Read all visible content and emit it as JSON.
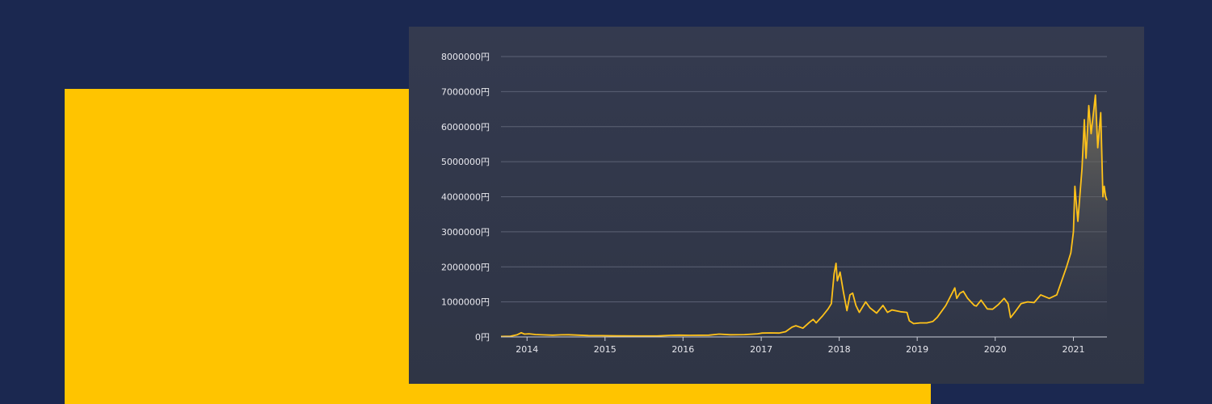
{
  "colors": {
    "background": "#1b2850",
    "accent": "#ffc400",
    "card": "#323849",
    "line": "#ffc21a",
    "grid": "#5c6275",
    "text": "#e8e8ee"
  },
  "chart_data": {
    "type": "area",
    "title": "",
    "xlabel": "",
    "ylabel": "",
    "ylim": [
      0,
      8000000
    ],
    "xlim": [
      "2013-09-01",
      "2021-06-07"
    ],
    "yticks": [
      0,
      1000000,
      2000000,
      3000000,
      4000000,
      5000000,
      6000000,
      7000000,
      8000000
    ],
    "ytick_labels": [
      "0円",
      "1000000円",
      "2000000円",
      "3000000円",
      "4000000円",
      "5000000円",
      "6000000円",
      "7000000円",
      "8000000円"
    ],
    "xticks": [
      "2014-01-01",
      "2015-01-01",
      "2016-01-01",
      "2017-01-01",
      "2018-01-01",
      "2019-01-01",
      "2020-01-01",
      "2021-01-01"
    ],
    "xtick_labels": [
      "2014",
      "2015",
      "2016",
      "2017",
      "2018",
      "2019",
      "2020",
      "2021"
    ],
    "grid": true,
    "legend": "none",
    "series": [
      {
        "points": [
          [
            "2013-09-01",
            13000
          ],
          [
            "2013-10-15",
            20000
          ],
          [
            "2013-11-15",
            60000
          ],
          [
            "2013-12-05",
            120000
          ],
          [
            "2013-12-20",
            80000
          ],
          [
            "2014-01-10",
            90000
          ],
          [
            "2014-02-10",
            70000
          ],
          [
            "2014-03-15",
            60000
          ],
          [
            "2014-05-01",
            50000
          ],
          [
            "2014-06-10",
            60000
          ],
          [
            "2014-07-15",
            62000
          ],
          [
            "2014-09-01",
            50000
          ],
          [
            "2014-10-15",
            40000
          ],
          [
            "2014-12-15",
            38000
          ],
          [
            "2015-03-01",
            30000
          ],
          [
            "2015-06-01",
            28000
          ],
          [
            "2015-09-01",
            28000
          ],
          [
            "2015-11-05",
            45000
          ],
          [
            "2015-12-15",
            50000
          ],
          [
            "2016-02-01",
            45000
          ],
          [
            "2016-05-01",
            50000
          ],
          [
            "2016-06-18",
            80000
          ],
          [
            "2016-08-10",
            62000
          ],
          [
            "2016-10-15",
            68000
          ],
          [
            "2016-12-15",
            90000
          ],
          [
            "2017-01-05",
            110000
          ],
          [
            "2017-02-15",
            115000
          ],
          [
            "2017-03-25",
            110000
          ],
          [
            "2017-04-25",
            150000
          ],
          [
            "2017-05-25",
            280000
          ],
          [
            "2017-06-12",
            320000
          ],
          [
            "2017-07-15",
            250000
          ],
          [
            "2017-08-15",
            420000
          ],
          [
            "2017-09-01",
            500000
          ],
          [
            "2017-09-15",
            400000
          ],
          [
            "2017-10-15",
            600000
          ],
          [
            "2017-11-10",
            800000
          ],
          [
            "2017-11-25",
            950000
          ],
          [
            "2017-12-08",
            1800000
          ],
          [
            "2017-12-17",
            2100000
          ],
          [
            "2017-12-23",
            1600000
          ],
          [
            "2018-01-05",
            1850000
          ],
          [
            "2018-01-20",
            1300000
          ],
          [
            "2018-02-06",
            750000
          ],
          [
            "2018-02-20",
            1200000
          ],
          [
            "2018-03-05",
            1250000
          ],
          [
            "2018-03-20",
            900000
          ],
          [
            "2018-04-05",
            700000
          ],
          [
            "2018-05-05",
            1000000
          ],
          [
            "2018-05-25",
            830000
          ],
          [
            "2018-06-25",
            680000
          ],
          [
            "2018-07-25",
            900000
          ],
          [
            "2018-08-15",
            700000
          ],
          [
            "2018-09-05",
            770000
          ],
          [
            "2018-10-15",
            720000
          ],
          [
            "2018-11-14",
            700000
          ],
          [
            "2018-11-25",
            460000
          ],
          [
            "2018-12-15",
            380000
          ],
          [
            "2019-01-15",
            400000
          ],
          [
            "2019-02-15",
            400000
          ],
          [
            "2019-03-15",
            440000
          ],
          [
            "2019-04-05",
            560000
          ],
          [
            "2019-05-15",
            900000
          ],
          [
            "2019-06-26",
            1400000
          ],
          [
            "2019-07-05",
            1100000
          ],
          [
            "2019-07-20",
            1250000
          ],
          [
            "2019-08-05",
            1300000
          ],
          [
            "2019-08-25",
            1100000
          ],
          [
            "2019-09-25",
            900000
          ],
          [
            "2019-10-05",
            880000
          ],
          [
            "2019-10-27",
            1050000
          ],
          [
            "2019-11-25",
            800000
          ],
          [
            "2019-12-20",
            790000
          ],
          [
            "2020-01-15",
            920000
          ],
          [
            "2020-02-12",
            1100000
          ],
          [
            "2020-03-01",
            950000
          ],
          [
            "2020-03-13",
            550000
          ],
          [
            "2020-04-01",
            700000
          ],
          [
            "2020-05-01",
            950000
          ],
          [
            "2020-06-01",
            1000000
          ],
          [
            "2020-07-01",
            980000
          ],
          [
            "2020-08-01",
            1200000
          ],
          [
            "2020-09-10",
            1100000
          ],
          [
            "2020-10-15",
            1200000
          ],
          [
            "2020-11-10",
            1650000
          ],
          [
            "2020-11-30",
            2000000
          ],
          [
            "2020-12-20",
            2400000
          ],
          [
            "2021-01-01",
            3000000
          ],
          [
            "2021-01-08",
            4300000
          ],
          [
            "2021-01-22",
            3300000
          ],
          [
            "2021-02-10",
            4800000
          ],
          [
            "2021-02-21",
            6200000
          ],
          [
            "2021-03-01",
            5100000
          ],
          [
            "2021-03-14",
            6600000
          ],
          [
            "2021-03-25",
            5800000
          ],
          [
            "2021-04-14",
            6900000
          ],
          [
            "2021-04-25",
            5400000
          ],
          [
            "2021-05-09",
            6400000
          ],
          [
            "2021-05-19",
            4000000
          ],
          [
            "2021-05-25",
            4300000
          ],
          [
            "2021-06-01",
            4000000
          ],
          [
            "2021-06-07",
            3900000
          ]
        ]
      }
    ]
  }
}
